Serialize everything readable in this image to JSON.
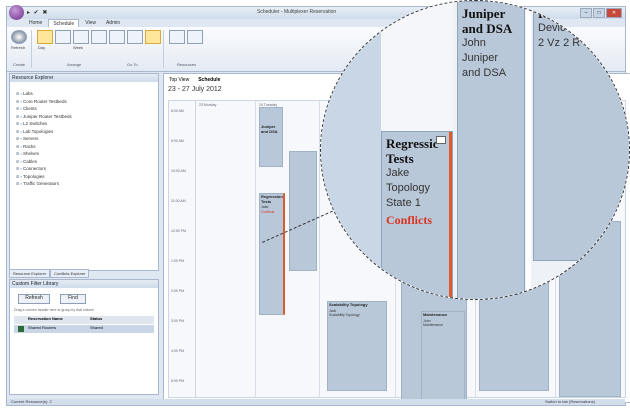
{
  "window": {
    "title": "Scheduler - Multiplexer Reservation",
    "qat": "▸ ✔ ✖"
  },
  "ribbon": {
    "tabs": [
      "Home",
      "Schedule",
      "View",
      "Admin"
    ],
    "active_tab": "Schedule",
    "groups": [
      "Create",
      "Arrange",
      "Go To",
      "Resources"
    ],
    "buttons": [
      "Refresh",
      "Day",
      "Work Week",
      "Week",
      "Month",
      "Timeline",
      "Schedule View",
      "Find",
      "Options"
    ]
  },
  "explorer": {
    "title": "Resource Explorer",
    "items": [
      "Labs",
      "Core Router Testbeds",
      "Clients",
      "Juniper Router Testbeds",
      "L2 Switches",
      "Lab Topologies",
      "Servers",
      "Racks",
      "Shelves",
      "Cables",
      "Connectors",
      "Topologies",
      "Traffic Generators"
    ],
    "tabs": [
      "Resource Explorer",
      "Conflicts Explorer"
    ]
  },
  "filter": {
    "title": "Custom Filter Library",
    "buttons": [
      "Refresh",
      "Find"
    ],
    "hint": "Drag a column header here to group by that column",
    "columns": [
      "Reservation Name",
      "Status"
    ],
    "row": {
      "name": "Shared Routers",
      "status": "Shared"
    }
  },
  "calendar": {
    "tabs": [
      "Top View",
      "Schedule"
    ],
    "date_range": "23 - 27 July 2012",
    "times": [
      "8:00 AM",
      "9:00 AM",
      "10:00 AM",
      "11:00 AM",
      "12:00 PM",
      "1:00 PM",
      "2:00 PM",
      "3:00 PM",
      "4:00 PM",
      "5:00 PM"
    ],
    "days": [
      "23 Monday",
      "24 Tuesday",
      "25 Wednesday",
      "26 Thursday",
      "27 Friday"
    ],
    "appointments": [
      {
        "title": "Juniper and DSA",
        "lines": [
          "John",
          "Juniper",
          "and DSA"
        ]
      },
      {
        "title": "Regression Tests",
        "lines": [
          "Jake",
          "Topology",
          "State 1"
        ],
        "conflict": "Conflicts"
      },
      {
        "title": "Scalability Topology",
        "lines": [
          "Jack",
          "Scalability Topology"
        ]
      },
      {
        "title": "Maintenance",
        "lines": [
          "John",
          "Maintenance"
        ]
      },
      {
        "title": "",
        "lines": [
          "2 Vz 2 Ra - 2 Engineers"
        ]
      }
    ]
  },
  "magnifier": {
    "regression": {
      "title1": "Regressic",
      "title2": "Tests",
      "l1": "Jake",
      "l2": "Topology",
      "l3": "State 1",
      "conflict": "Conflicts"
    },
    "juniper": {
      "title1": "Juniper",
      "title2": "and DSA",
      "l1": "John",
      "l2": "Juniper",
      "l3": "and DSA"
    },
    "right": {
      "t": "R",
      "l1": "Devic",
      "l2": "2 Vz 2 R"
    }
  },
  "status": {
    "left": "Current Resource(s): 2",
    "right": "Switch to tab (Reservations)"
  }
}
